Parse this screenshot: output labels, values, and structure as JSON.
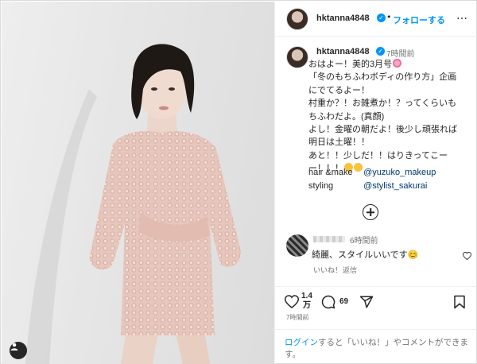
{
  "header": {
    "username": "hktanna4848",
    "verified_mark": "✓",
    "separator": "•",
    "follow_label": "フォローする",
    "more_label": "…"
  },
  "caption": {
    "username": "hktanna4848",
    "time": "7時間前",
    "lines": [
      "おはよー！美的3月号",
      "「冬のもちふわボディの作り方」企画",
      "にでてるよー！",
      "村重か？！お雑煮か！？ってくらいも",
      "ちふわだよ。(真顔)",
      "よし！金曜の朝だよ！後少し頑張れば",
      "明日は土曜！！",
      "あと！！少しだ！！はりきってこー",
      "ー！！！"
    ],
    "credits": [
      {
        "label": "hair &make",
        "handle": "@yuzuko_makeup"
      },
      {
        "label": "styling",
        "handle": "@stylist_sakurai"
      }
    ]
  },
  "comment": {
    "time": "6時間前",
    "text": "綺麗、スタイルいいです😊",
    "like_label": "いいね！",
    "reply_label": "返信"
  },
  "actions": {
    "likes_top": "1.4",
    "likes_bottom": "万",
    "comments_count": "69",
    "post_time": "7時間前"
  },
  "login_prompt": {
    "link_text": "ログイン",
    "rest_text": "すると「いいね！」やコメントができます。"
  },
  "icons": {
    "more": "more-dots-icon",
    "add": "plus-circle-icon",
    "like": "heart-icon",
    "comment": "comment-bubble-icon",
    "share": "share-plane-icon",
    "save": "bookmark-icon",
    "user_tag": "user-tag-icon"
  },
  "colors": {
    "accent": "#0095f6",
    "link": "#00376b",
    "muted": "#737373",
    "text": "#262626"
  }
}
